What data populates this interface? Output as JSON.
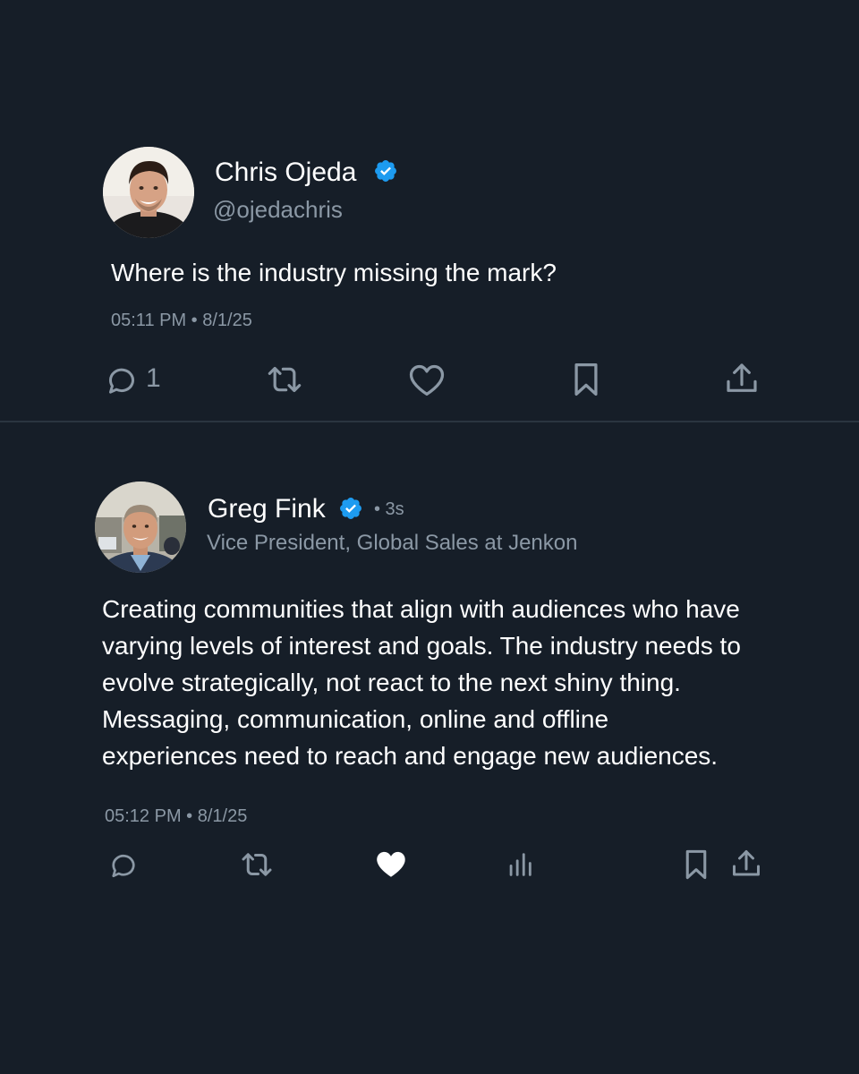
{
  "colors": {
    "background": "#161e28",
    "text_primary": "#ffffff",
    "text_secondary": "#8b98a5",
    "verified_blue": "#1d9bf0",
    "divider": "#2a3540"
  },
  "post1": {
    "author_name": "Chris Ojeda",
    "handle": "@ojedachris",
    "verified": true,
    "avatar": "avatar-chris",
    "text": "Where is the industry missing the mark?",
    "timestamp": "05:11 PM • 8/1/25",
    "actions": {
      "reply_count": "1",
      "icons": [
        "reply-icon",
        "retweet-icon",
        "like-icon",
        "bookmark-icon",
        "share-icon"
      ]
    }
  },
  "post2": {
    "author_name": "Greg Fink",
    "time_ago": "• 3s",
    "subtitle": "Vice President, Global Sales at Jenkon",
    "verified": true,
    "avatar": "avatar-greg",
    "text_lines": [
      "Creating communities that align with audiences who have",
      "varying levels of interest and goals. The industry needs to",
      "evolve strategically, not react to the next shiny thing.",
      "Messaging, communication, online and offline",
      "experiences need to reach and engage new audiences."
    ],
    "timestamp": "05:12 PM • 8/1/25",
    "actions": {
      "liked": true,
      "icons": [
        "reply-icon",
        "retweet-icon",
        "like-icon-filled",
        "views-icon",
        "bookmark-icon",
        "share-icon"
      ]
    }
  }
}
